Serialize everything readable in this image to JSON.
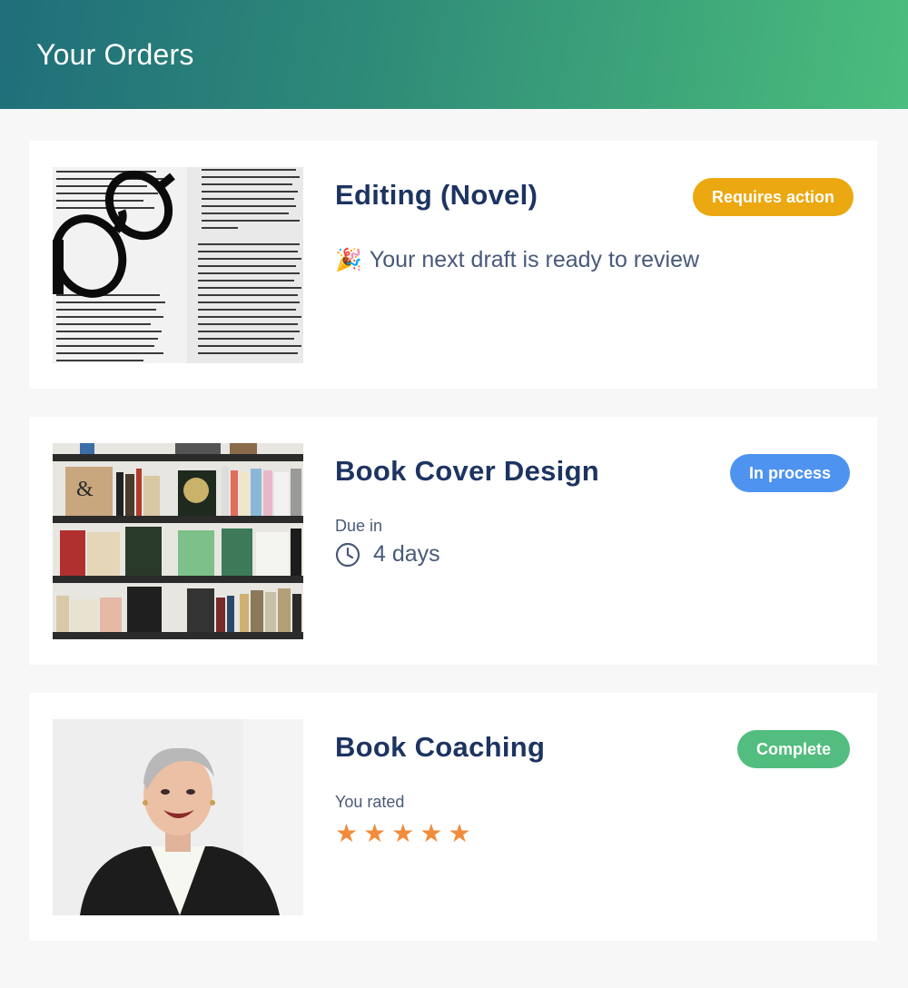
{
  "header": {
    "title": "Your Orders"
  },
  "orders": [
    {
      "title": "Editing (Novel)",
      "status": "Requires action",
      "status_color": "#eca811",
      "note_emoji": "🎉",
      "note": "Your next draft is ready to review",
      "thumbnail": "book-pages-with-glasses"
    },
    {
      "title": "Book Cover Design",
      "status": "In process",
      "status_color": "#4e93f0",
      "due_label": "Due in",
      "due_value": "4 days",
      "icon": "clock-icon",
      "thumbnail": "bookshelf"
    },
    {
      "title": "Book Coaching",
      "status": "Complete",
      "status_color": "#52bd7e",
      "rating_label": "You rated",
      "rating": 5,
      "rating_max": 5,
      "star_glyph": "★",
      "thumbnail": "smiling-woman-portrait"
    }
  ],
  "colors": {
    "header_gradient_start": "#1f6e7a",
    "header_gradient_end": "#4bbd7c",
    "title_text": "#1d3461",
    "star": "#f08c3c"
  }
}
